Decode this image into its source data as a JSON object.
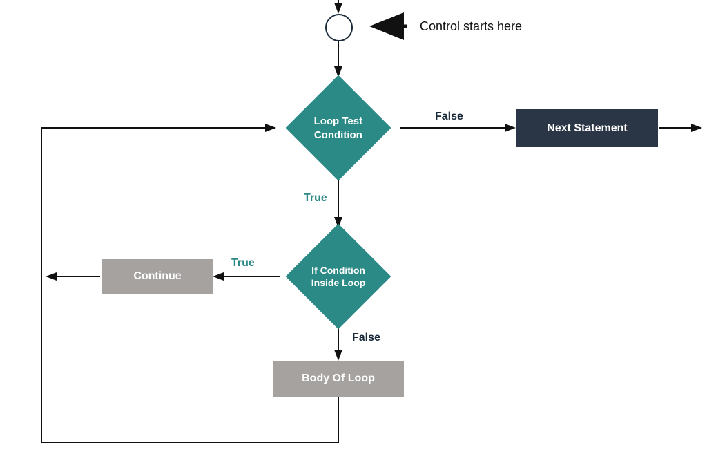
{
  "caption": "Control starts here",
  "nodes": {
    "loop_test": "Loop Test\nCondition",
    "if_inside": "If Condition\nInside Loop",
    "next_statement": "Next Statement",
    "continue": "Continue",
    "body": "Body Of Loop"
  },
  "edges": {
    "loop_test_false": "False",
    "loop_test_true": "True",
    "if_true": "True",
    "if_false": "False"
  },
  "colors": {
    "teal": "#2c8a86",
    "dark": "#2a3545",
    "gray": "#a5a2a0",
    "line": "#111111"
  }
}
